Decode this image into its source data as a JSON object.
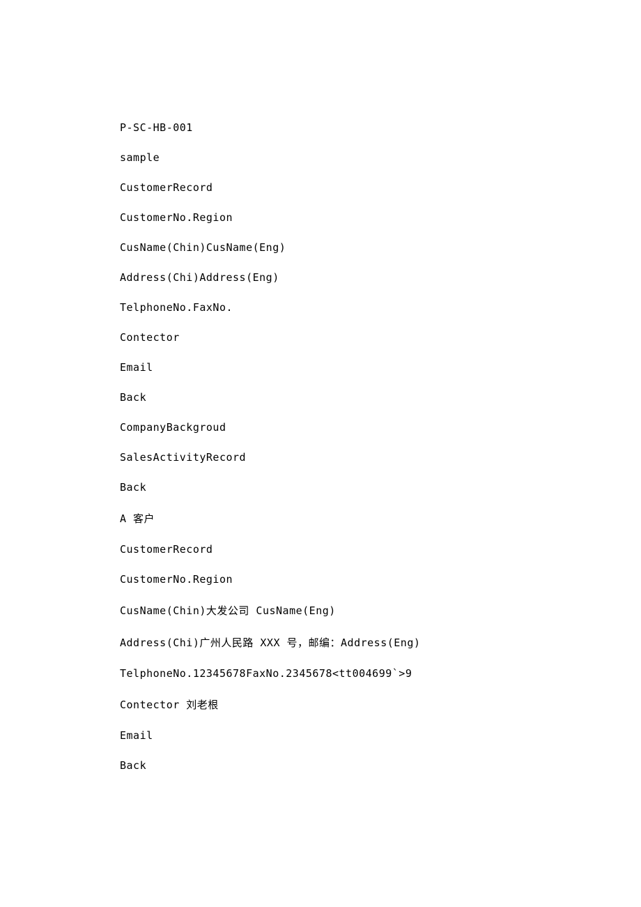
{
  "lines": {
    "l0": "P-SC-HB-001",
    "l1": "sample",
    "l2": "CustomerRecord",
    "l3": "CustomerNo.Region",
    "l4": "CusName(Chin)CusName(Eng)",
    "l5": "Address(Chi)Address(Eng)",
    "l6": "TelphoneNo.FaxNo.",
    "l7": "Contector",
    "l8": "Email",
    "l9": "Back",
    "l10": "CompanyBackgroud",
    "l11": "SalesActivityRecord",
    "l12": "Back",
    "l13": "A 客户",
    "l14": "CustomerRecord",
    "l15": "CustomerNo.Region",
    "l16": "CusName(Chin)大发公司 CusName(Eng)",
    "l17": "Address(Chi)广州人民路 XXX 号，邮编：Address(Eng)",
    "l18": "TelphoneNo.12345678FaxNo.2345678<tt004699`>9",
    "l19": "Contector 刘老根",
    "l20": "Email",
    "l21": "Back"
  }
}
